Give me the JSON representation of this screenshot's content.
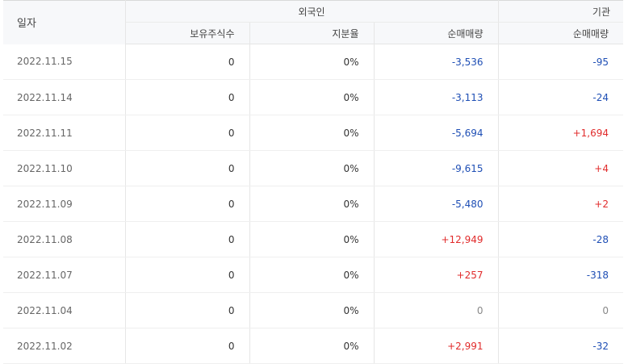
{
  "header": {
    "date": "일자",
    "foreign_group": "외국인",
    "institution_group": "기관",
    "holdings": "보유주식수",
    "share_ratio": "지분율",
    "foreign_net": "순매매량",
    "institution_net": "순매매량"
  },
  "colors": {
    "down": "#1f4fb5",
    "up": "#e12c2c",
    "zero": "#888888"
  },
  "rows": [
    {
      "date": "2022.11.15",
      "holdings": "0",
      "ratio": "0%",
      "foreign_net": "-3,536",
      "foreign_dir": "down",
      "inst_net": "-95",
      "inst_dir": "down"
    },
    {
      "date": "2022.11.14",
      "holdings": "0",
      "ratio": "0%",
      "foreign_net": "-3,113",
      "foreign_dir": "down",
      "inst_net": "-24",
      "inst_dir": "down"
    },
    {
      "date": "2022.11.11",
      "holdings": "0",
      "ratio": "0%",
      "foreign_net": "-5,694",
      "foreign_dir": "down",
      "inst_net": "+1,694",
      "inst_dir": "up"
    },
    {
      "date": "2022.11.10",
      "holdings": "0",
      "ratio": "0%",
      "foreign_net": "-9,615",
      "foreign_dir": "down",
      "inst_net": "+4",
      "inst_dir": "up"
    },
    {
      "date": "2022.11.09",
      "holdings": "0",
      "ratio": "0%",
      "foreign_net": "-5,480",
      "foreign_dir": "down",
      "inst_net": "+2",
      "inst_dir": "up"
    },
    {
      "date": "2022.11.08",
      "holdings": "0",
      "ratio": "0%",
      "foreign_net": "+12,949",
      "foreign_dir": "up",
      "inst_net": "-28",
      "inst_dir": "down"
    },
    {
      "date": "2022.11.07",
      "holdings": "0",
      "ratio": "0%",
      "foreign_net": "+257",
      "foreign_dir": "up",
      "inst_net": "-318",
      "inst_dir": "down"
    },
    {
      "date": "2022.11.04",
      "holdings": "0",
      "ratio": "0%",
      "foreign_net": "0",
      "foreign_dir": "zero",
      "inst_net": "0",
      "inst_dir": "zero"
    },
    {
      "date": "2022.11.02",
      "holdings": "0",
      "ratio": "0%",
      "foreign_net": "+2,991",
      "foreign_dir": "up",
      "inst_net": "-32",
      "inst_dir": "down"
    }
  ]
}
